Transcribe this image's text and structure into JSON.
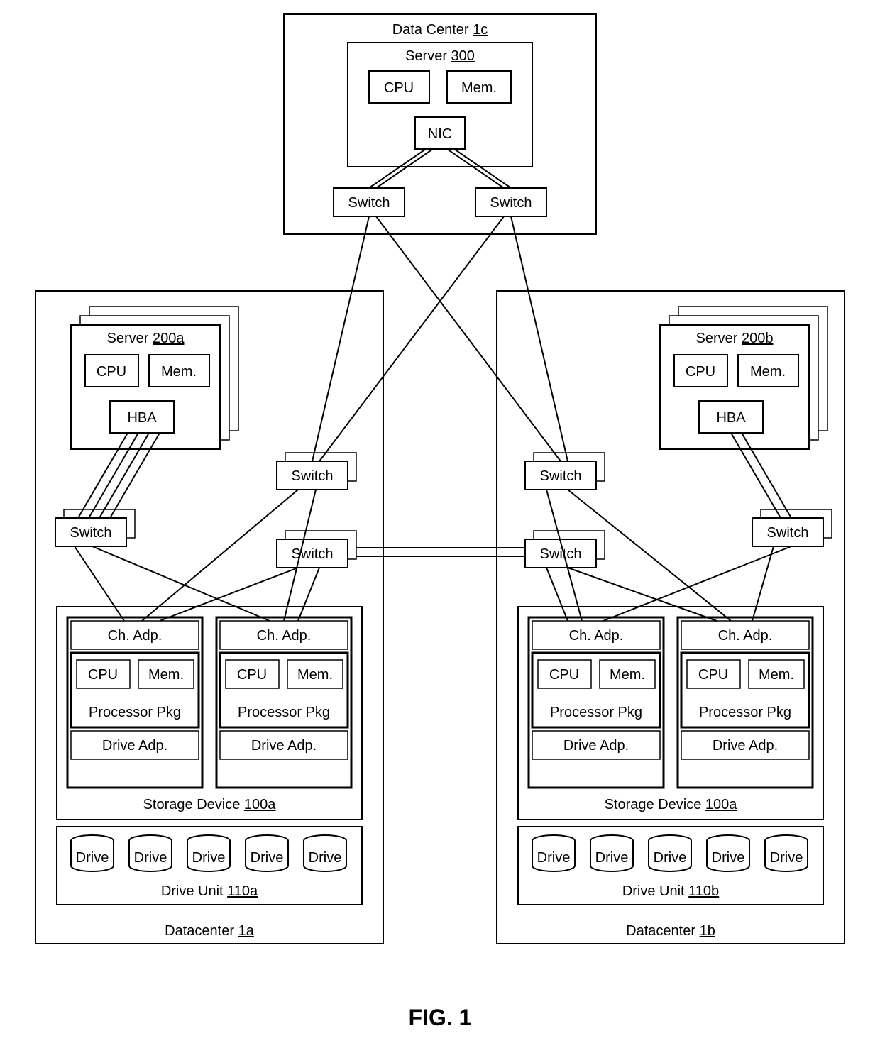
{
  "figure_label": "FIG. 1",
  "top_dc": {
    "title": "Data Center",
    "ref": "1c",
    "server": {
      "title": "Server",
      "ref": "300",
      "cpu": "CPU",
      "mem": "Mem.",
      "nic": "NIC"
    },
    "switch_a": "Switch",
    "switch_b": "Switch"
  },
  "left_dc": {
    "title": "Datacenter",
    "ref": "1a",
    "server": {
      "title": "Server",
      "ref": "200a",
      "cpu": "CPU",
      "mem": "Mem.",
      "hba": "HBA"
    },
    "switches": {
      "s1": "Switch",
      "s2": "Switch",
      "s3": "Switch"
    },
    "storage": {
      "title": "Storage Device",
      "ref": "100a",
      "ca": "Ch. Adp.",
      "cpu": "CPU",
      "mem": "Mem.",
      "ppkg": "Processor Pkg",
      "da": "Drive Adp."
    },
    "drive_unit": {
      "title": "Drive Unit",
      "ref": "110a",
      "drive": "Drive"
    }
  },
  "right_dc": {
    "title": "Datacenter",
    "ref": "1b",
    "server": {
      "title": "Server",
      "ref": "200b",
      "cpu": "CPU",
      "mem": "Mem.",
      "hba": "HBA"
    },
    "switches": {
      "s1": "Switch",
      "s2": "Switch",
      "s3": "Switch"
    },
    "storage": {
      "title": "Storage Device",
      "ref": "100a",
      "ca": "Ch. Adp.",
      "cpu": "CPU",
      "mem": "Mem.",
      "ppkg": "Processor Pkg",
      "da": "Drive Adp."
    },
    "drive_unit": {
      "title": "Drive Unit",
      "ref": "110b",
      "drive": "Drive"
    }
  },
  "chart_data": {
    "type": "table",
    "title": "FIG. 1 — Data-center system topology",
    "nodes": [
      {
        "id": "dc1c",
        "label": "Data Center 1c"
      },
      {
        "id": "srv300",
        "label": "Server 300",
        "parent": "dc1c",
        "parts": [
          "CPU",
          "Mem.",
          "NIC"
        ]
      },
      {
        "id": "dc1c_sw1",
        "label": "Switch",
        "parent": "dc1c"
      },
      {
        "id": "dc1c_sw2",
        "label": "Switch",
        "parent": "dc1c"
      },
      {
        "id": "dc1a",
        "label": "Datacenter 1a"
      },
      {
        "id": "srv200a",
        "label": "Server 200a",
        "parent": "dc1a",
        "parts": [
          "CPU",
          "Mem.",
          "HBA"
        ],
        "stacked": true
      },
      {
        "id": "dc1a_sw1",
        "label": "Switch",
        "parent": "dc1a",
        "stacked": true
      },
      {
        "id": "dc1a_sw2",
        "label": "Switch",
        "parent": "dc1a",
        "stacked": true
      },
      {
        "id": "dc1a_sw3",
        "label": "Switch",
        "parent": "dc1a",
        "stacked": true
      },
      {
        "id": "sd100a_L",
        "label": "Storage Device 100a",
        "parent": "dc1a",
        "controllers": 2,
        "controller_parts": [
          "Ch. Adp.",
          "CPU",
          "Mem.",
          "Processor Pkg",
          "Drive Adp."
        ]
      },
      {
        "id": "du110a",
        "label": "Drive Unit 110a",
        "parent": "dc1a",
        "drives": 5
      },
      {
        "id": "dc1b",
        "label": "Datacenter 1b"
      },
      {
        "id": "srv200b",
        "label": "Server 200b",
        "parent": "dc1b",
        "parts": [
          "CPU",
          "Mem.",
          "HBA"
        ],
        "stacked": true
      },
      {
        "id": "dc1b_sw1",
        "label": "Switch",
        "parent": "dc1b",
        "stacked": true
      },
      {
        "id": "dc1b_sw2",
        "label": "Switch",
        "parent": "dc1b",
        "stacked": true
      },
      {
        "id": "dc1b_sw3",
        "label": "Switch",
        "parent": "dc1b",
        "stacked": true
      },
      {
        "id": "sd100a_R",
        "label": "Storage Device 100a",
        "parent": "dc1b",
        "controllers": 2,
        "controller_parts": [
          "Ch. Adp.",
          "CPU",
          "Mem.",
          "Processor Pkg",
          "Drive Adp."
        ]
      },
      {
        "id": "du110b",
        "label": "Drive Unit 110b",
        "parent": "dc1b",
        "drives": 5
      }
    ],
    "edges": [
      [
        "srv300.NIC",
        "dc1c_sw1"
      ],
      [
        "srv300.NIC",
        "dc1c_sw2"
      ],
      [
        "dc1c_sw1",
        "dc1a_sw2"
      ],
      [
        "dc1c_sw1",
        "dc1b_sw2"
      ],
      [
        "dc1c_sw2",
        "dc1a_sw2"
      ],
      [
        "dc1c_sw2",
        "dc1b_sw2"
      ],
      [
        "srv200a.HBA",
        "dc1a_sw1"
      ],
      [
        "srv200a.HBA",
        "dc1a_sw1"
      ],
      [
        "srv200a.HBA",
        "dc1a_sw1"
      ],
      [
        "dc1a_sw1",
        "sd100a_L.ctrl1.ChAdp"
      ],
      [
        "dc1a_sw1",
        "sd100a_L.ctrl2.ChAdp"
      ],
      [
        "dc1a_sw2",
        "sd100a_L.ctrl1.ChAdp"
      ],
      [
        "dc1a_sw2",
        "sd100a_L.ctrl2.ChAdp"
      ],
      [
        "dc1a_sw3",
        "sd100a_L.ctrl1.ChAdp"
      ],
      [
        "dc1a_sw3",
        "sd100a_L.ctrl2.ChAdp"
      ],
      [
        "srv200b.HBA",
        "dc1b_sw1"
      ],
      [
        "dc1b_sw1",
        "sd100a_R.ctrl1.ChAdp"
      ],
      [
        "dc1b_sw1",
        "sd100a_R.ctrl2.ChAdp"
      ],
      [
        "dc1b_sw2",
        "sd100a_R.ctrl1.ChAdp"
      ],
      [
        "dc1b_sw2",
        "sd100a_R.ctrl2.ChAdp"
      ],
      [
        "dc1b_sw3",
        "sd100a_R.ctrl1.ChAdp"
      ],
      [
        "dc1b_sw3",
        "sd100a_R.ctrl2.ChAdp"
      ],
      [
        "dc1a_sw3",
        "dc1b_sw3"
      ],
      [
        "dc1a_sw3",
        "dc1b_sw3"
      ]
    ]
  }
}
